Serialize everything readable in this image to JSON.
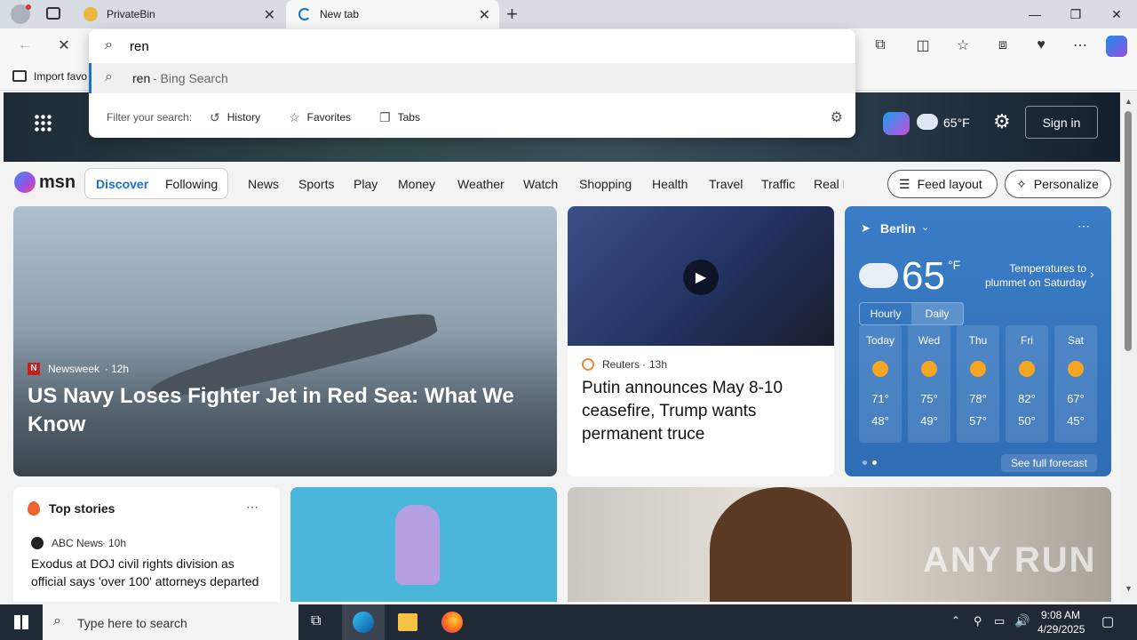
{
  "tabs": [
    {
      "title": "PrivateBin"
    },
    {
      "title": "New tab"
    }
  ],
  "address": {
    "value": "ren"
  },
  "favorites_bar": {
    "import_label": "Import favo"
  },
  "suggestions": [
    {
      "query": "ren",
      "suffix": " - Bing Search"
    }
  ],
  "filters": {
    "label": "Filter your search:",
    "items": [
      "History",
      "Favorites",
      "Tabs"
    ]
  },
  "hero": {
    "temp": "65°F",
    "signin": "Sign in"
  },
  "msn": {
    "logo": "msn",
    "tabs": [
      "Discover",
      "Following"
    ],
    "nav": [
      "News",
      "Sports",
      "Play",
      "Money",
      "Weather",
      "Watch",
      "Shopping",
      "Health",
      "Travel",
      "Traffic",
      "Real E"
    ],
    "feed_layout": "Feed layout",
    "personalize": "Personalize"
  },
  "main_story": {
    "source": "Newsweek",
    "age": "12h",
    "headline": "US Navy Loses Fighter Jet in Red Sea: What We Know"
  },
  "story2": {
    "source": "Reuters",
    "age": "13h",
    "headline": "Putin announces May 8-10 ceasefire, Trump wants permanent truce"
  },
  "weather": {
    "city": "Berlin",
    "temp": "65",
    "unit": "°F",
    "alert": "Temperatures to plummet on Saturday",
    "tabs": [
      "Hourly",
      "Daily"
    ],
    "days": [
      {
        "d": "Today",
        "hi": "71°",
        "lo": "48°"
      },
      {
        "d": "Wed",
        "hi": "75°",
        "lo": "49°"
      },
      {
        "d": "Thu",
        "hi": "78°",
        "lo": "57°"
      },
      {
        "d": "Fri",
        "hi": "82°",
        "lo": "50°"
      },
      {
        "d": "Sat",
        "hi": "67°",
        "lo": "45°"
      }
    ],
    "see_full": "See full forecast"
  },
  "top_stories": {
    "title": "Top stories",
    "source": "ABC News",
    "age": "10h",
    "headline": "Exodus at DOJ civil rights division as official says 'over 100' attorneys departed"
  },
  "watermark": "ANY RUN",
  "taskbar": {
    "search_placeholder": "Type here to search",
    "time": "9:08 AM",
    "date": "4/29/2025"
  },
  "colors": {
    "accent": "#1a6fd1",
    "weather_bg": "#2f6db5",
    "taskbar": "#1f2a36"
  }
}
